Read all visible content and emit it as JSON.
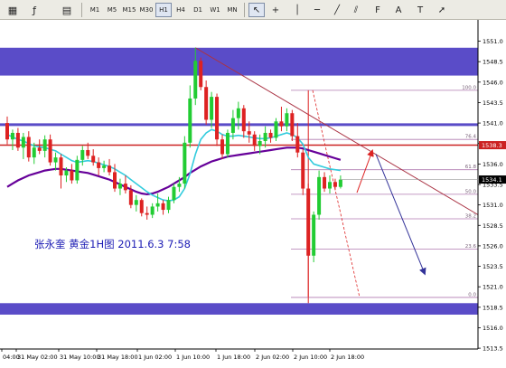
{
  "toolbar": {
    "periods": [
      "M1",
      "M5",
      "M15",
      "M30",
      "H1",
      "H4",
      "D1",
      "W1",
      "MN"
    ],
    "active_period": "H1",
    "tools": [
      "new-chart-icon",
      "indicators-icon",
      "chart-template-icon",
      "cursor-icon",
      "crosshair-icon",
      "vertical-line-icon",
      "horizontal-line-icon",
      "trendline-icon",
      "equidistant-channel-icon",
      "fibonacci-icon",
      "text-icon",
      "text-label-icon",
      "arrow-icon"
    ]
  },
  "chart": {
    "caption": "张永奎  黄金1H图   2011.6.3  7:58",
    "current_price": "1534.1",
    "level_tag": "1538.3",
    "colors": {
      "zone": "#5a4cc8",
      "red_line": "#cc2222",
      "bull": "#22cc33",
      "bear": "#dd2222",
      "ma_fast": "#33ccdd",
      "ma_slow": "#660099",
      "fib": "#b07ab0",
      "trend": "#aa3344",
      "blue_arrow": "#333399"
    }
  },
  "chart_data": {
    "type": "candlestick",
    "title": "",
    "ylim": [
      1513.4,
      1553.6
    ],
    "price_ticks": [
      "1551.0",
      "1548.5",
      "1546.0",
      "1543.5",
      "1541.0",
      "1538.5",
      "1536.0",
      "1533.5",
      "1531.0",
      "1528.5",
      "1526.0",
      "1523.5",
      "1521.0",
      "1518.5",
      "1516.0",
      "1513.5"
    ],
    "time_labels": [
      "04:00",
      "31 May 02:00",
      "31 May 10:00",
      "31 May 18:00",
      "1 Jun 02:00",
      "1 Jun 10:00",
      "1 Jun 18:00",
      "2 Jun 02:00",
      "2 Jun 10:00",
      "2 Jun 18:00"
    ],
    "zones": [
      {
        "name": "upper-zone",
        "from": 1546.8,
        "to": 1550.2
      },
      {
        "name": "lower-zone",
        "from": 1517.6,
        "to": 1519.0
      }
    ],
    "support_line": 1540.8,
    "resistance_line": 1538.3,
    "fibonacci": [
      {
        "label": "100.0",
        "price": 1545.0
      },
      {
        "label": "76.4",
        "price": 1539.0
      },
      {
        "label": "61.8",
        "price": 1535.3
      },
      {
        "label": "50.0",
        "price": 1532.3
      },
      {
        "label": "38.2",
        "price": 1529.3
      },
      {
        "label": "23.6",
        "price": 1525.6
      },
      {
        "label": "0.0",
        "price": 1519.7
      }
    ],
    "candles": [
      [
        1541.0,
        1541.8,
        1538.4,
        1539.0
      ],
      [
        1539.0,
        1540.2,
        1537.7,
        1539.8
      ],
      [
        1539.8,
        1540.4,
        1537.6,
        1538.0
      ],
      [
        1538.0,
        1539.8,
        1536.6,
        1539.3
      ],
      [
        1539.3,
        1540.0,
        1536.3,
        1536.8
      ],
      [
        1536.8,
        1538.6,
        1536.0,
        1538.0
      ],
      [
        1538.0,
        1539.0,
        1537.2,
        1537.6
      ],
      [
        1537.6,
        1539.5,
        1536.8,
        1539.0
      ],
      [
        1539.0,
        1539.6,
        1535.8,
        1536.2
      ],
      [
        1536.2,
        1537.4,
        1535.2,
        1536.8
      ],
      [
        1536.8,
        1537.2,
        1533.0,
        1534.6
      ],
      [
        1534.6,
        1535.6,
        1533.8,
        1535.2
      ],
      [
        1535.2,
        1536.0,
        1533.6,
        1534.0
      ],
      [
        1534.0,
        1537.0,
        1533.6,
        1536.5
      ],
      [
        1536.5,
        1538.2,
        1535.8,
        1537.7
      ],
      [
        1537.7,
        1538.6,
        1536.6,
        1537.0
      ],
      [
        1537.0,
        1537.8,
        1535.8,
        1536.2
      ],
      [
        1536.2,
        1536.8,
        1534.6,
        1535.5
      ],
      [
        1535.5,
        1536.4,
        1535.0,
        1535.8
      ],
      [
        1535.8,
        1536.6,
        1534.6,
        1535.0
      ],
      [
        1535.0,
        1536.0,
        1532.6,
        1533.0
      ],
      [
        1533.0,
        1534.2,
        1532.2,
        1533.6
      ],
      [
        1533.6,
        1534.6,
        1532.4,
        1532.8
      ],
      [
        1532.8,
        1533.4,
        1530.6,
        1531.0
      ],
      [
        1531.0,
        1532.2,
        1530.2,
        1531.6
      ],
      [
        1531.6,
        1531.8,
        1529.6,
        1530.0
      ],
      [
        1530.0,
        1530.8,
        1529.2,
        1529.8
      ],
      [
        1529.8,
        1531.2,
        1529.4,
        1530.8
      ],
      [
        1530.8,
        1532.4,
        1530.2,
        1531.2
      ],
      [
        1531.2,
        1531.6,
        1529.8,
        1530.4
      ],
      [
        1530.4,
        1532.0,
        1530.0,
        1531.6
      ],
      [
        1531.6,
        1533.6,
        1531.2,
        1533.2
      ],
      [
        1533.2,
        1534.4,
        1532.6,
        1533.6
      ],
      [
        1533.6,
        1539.4,
        1533.0,
        1538.6
      ],
      [
        1538.6,
        1545.6,
        1538.0,
        1544.0
      ],
      [
        1544.0,
        1550.2,
        1543.2,
        1548.6
      ],
      [
        1548.6,
        1549.0,
        1545.0,
        1545.4
      ],
      [
        1545.4,
        1546.2,
        1540.8,
        1541.4
      ],
      [
        1541.4,
        1544.8,
        1540.4,
        1544.2
      ],
      [
        1544.2,
        1544.6,
        1538.2,
        1539.0
      ],
      [
        1539.0,
        1539.6,
        1536.6,
        1537.2
      ],
      [
        1537.2,
        1540.2,
        1536.8,
        1539.8
      ],
      [
        1539.8,
        1542.6,
        1539.0,
        1541.6
      ],
      [
        1541.6,
        1543.6,
        1540.2,
        1542.8
      ],
      [
        1542.8,
        1543.2,
        1539.2,
        1540.0
      ],
      [
        1540.0,
        1541.2,
        1538.6,
        1539.6
      ],
      [
        1539.6,
        1540.0,
        1537.6,
        1538.2
      ],
      [
        1538.2,
        1539.6,
        1537.2,
        1538.8
      ],
      [
        1538.8,
        1540.6,
        1538.0,
        1539.8
      ],
      [
        1539.8,
        1540.2,
        1538.6,
        1539.2
      ],
      [
        1539.2,
        1541.6,
        1538.8,
        1541.2
      ],
      [
        1541.2,
        1543.0,
        1540.0,
        1540.6
      ],
      [
        1540.6,
        1542.8,
        1540.0,
        1542.2
      ],
      [
        1542.2,
        1542.6,
        1538.8,
        1539.4
      ],
      [
        1539.4,
        1541.0,
        1536.8,
        1537.4
      ],
      [
        1537.4,
        1537.8,
        1532.2,
        1533.0
      ],
      [
        1533.0,
        1533.6,
        1519.8,
        1524.8
      ],
      [
        1524.8,
        1530.2,
        1524.0,
        1529.8
      ],
      [
        1529.8,
        1535.2,
        1529.2,
        1534.4
      ],
      [
        1534.4,
        1535.0,
        1532.6,
        1533.0
      ],
      [
        1533.0,
        1534.6,
        1532.4,
        1533.8
      ],
      [
        1533.8,
        1534.2,
        1532.8,
        1533.2
      ],
      [
        1533.2,
        1534.6,
        1533.0,
        1534.1
      ]
    ],
    "ma_fast": [
      1539.6,
      1539.3,
      1539.0,
      1538.8,
      1538.5,
      1538.2,
      1538.1,
      1538.0,
      1537.8,
      1537.6,
      1537.2,
      1536.8,
      1536.4,
      1536.2,
      1536.3,
      1536.4,
      1536.3,
      1536.1,
      1535.9,
      1535.7,
      1535.4,
      1535.0,
      1534.6,
      1534.1,
      1533.6,
      1533.1,
      1532.6,
      1532.2,
      1531.9,
      1531.6,
      1531.5,
      1531.6,
      1532.0,
      1533.0,
      1534.8,
      1537.2,
      1539.0,
      1539.8,
      1540.2,
      1540.0,
      1539.6,
      1539.4,
      1539.4,
      1539.5,
      1539.4,
      1539.3,
      1539.2,
      1539.1,
      1539.1,
      1539.2,
      1539.4,
      1539.6,
      1539.8,
      1539.6,
      1539.2,
      1538.4,
      1536.8,
      1536.0,
      1535.8,
      1535.6,
      1535.4,
      1535.3,
      1535.2
    ],
    "ma_slow": [
      1533.2,
      1533.6,
      1534.0,
      1534.3,
      1534.6,
      1534.8,
      1535.0,
      1535.2,
      1535.3,
      1535.4,
      1535.4,
      1535.3,
      1535.2,
      1535.1,
      1535.0,
      1534.9,
      1534.7,
      1534.5,
      1534.3,
      1534.1,
      1533.8,
      1533.5,
      1533.2,
      1532.9,
      1532.6,
      1532.4,
      1532.3,
      1532.4,
      1532.6,
      1532.9,
      1533.2,
      1533.6,
      1534.0,
      1534.4,
      1534.9,
      1535.3,
      1535.7,
      1536.0,
      1536.3,
      1536.5,
      1536.7,
      1536.9,
      1537.0,
      1537.1,
      1537.2,
      1537.3,
      1537.4,
      1537.5,
      1537.6,
      1537.7,
      1537.8,
      1537.9,
      1538.0,
      1538.0,
      1538.0,
      1537.9,
      1537.7,
      1537.5,
      1537.3,
      1537.1,
      1536.9,
      1536.7,
      1536.5
    ]
  }
}
